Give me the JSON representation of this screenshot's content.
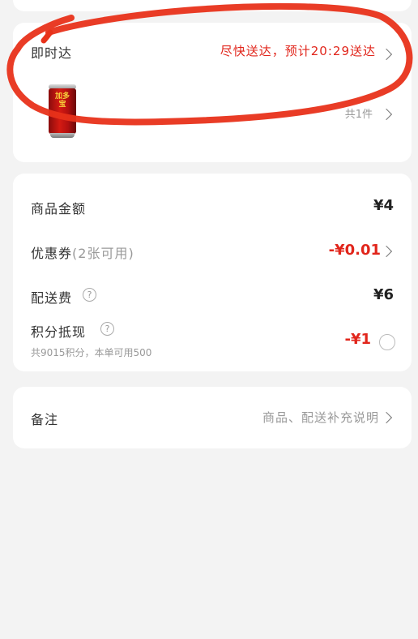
{
  "delivery": {
    "title": "即时达",
    "eta": "尽快送达，预计20:29送达",
    "item_count": "共1件",
    "product_can_text": "加多宝"
  },
  "fees": {
    "goods_amount": {
      "label": "商品金额",
      "value": "¥4"
    },
    "coupon": {
      "label": "优惠券",
      "available": "(2张可用)",
      "value": "-¥0.01"
    },
    "delivery_fee": {
      "label": "配送费",
      "value": "¥6"
    },
    "points": {
      "label": "积分抵现",
      "detail": "共9015积分，本单可用500",
      "value": "-¥1"
    }
  },
  "note": {
    "label": "备注",
    "placeholder": "商品、配送补充说明"
  },
  "colors": {
    "accent_red": "#e1251b",
    "background": "#f3f3f3",
    "annotation_red": "#e8321a"
  },
  "icons": [
    "chevron-right-icon",
    "help-circle-icon",
    "radio-unchecked-icon"
  ]
}
